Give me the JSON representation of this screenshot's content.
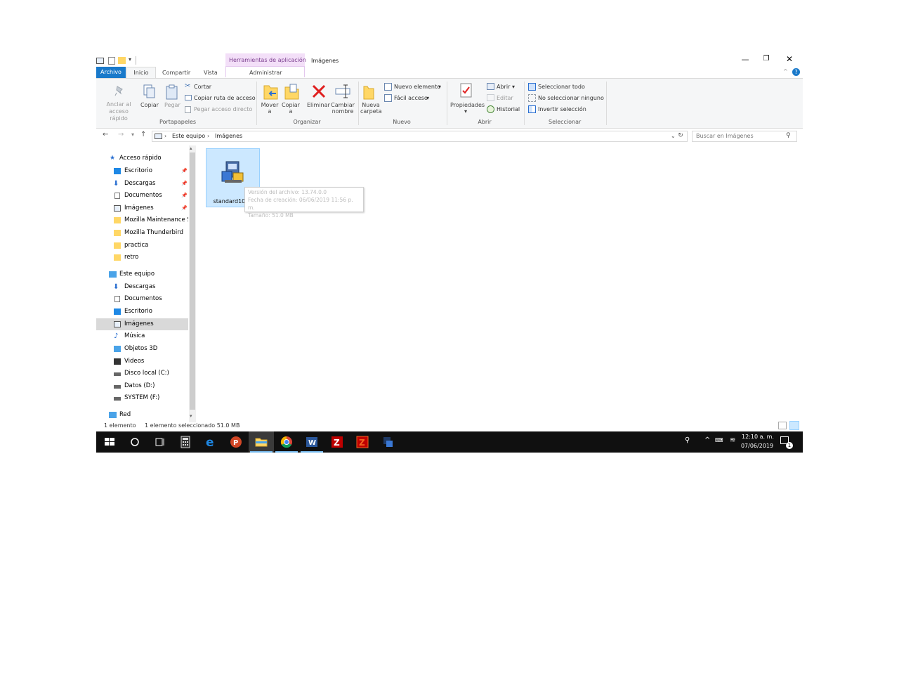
{
  "window": {
    "context_tab": "Herramientas de aplicación",
    "title": "Imágenes",
    "tabs": {
      "file": "Archivo",
      "home": "Inicio",
      "share": "Compartir",
      "view": "Vista",
      "manage": "Administrar"
    }
  },
  "ribbon": {
    "clipboard": {
      "pin": "Anclar al acceso rápido",
      "copy": "Copiar",
      "paste": "Pegar",
      "cut": "Cortar",
      "copy_path": "Copiar ruta de acceso",
      "paste_shortcut": "Pegar acceso directo",
      "group": "Portapapeles"
    },
    "organize": {
      "move_to": "Mover a",
      "copy_to": "Copiar a",
      "delete": "Eliminar",
      "rename": "Cambiar nombre",
      "group": "Organizar"
    },
    "new": {
      "new_folder": "Nueva carpeta",
      "new_item": "Nuevo elemento",
      "easy_access": "Fácil acceso",
      "group": "Nuevo"
    },
    "open": {
      "properties": "Propiedades",
      "open": "Abrir",
      "edit": "Editar",
      "history": "Historial",
      "group": "Abrir"
    },
    "select": {
      "select_all": "Seleccionar todo",
      "select_none": "No seleccionar ninguno",
      "invert": "Invertir selección",
      "group": "Seleccionar"
    }
  },
  "address": {
    "crumbs": [
      "Este equipo",
      "Imágenes"
    ],
    "search_placeholder": "Buscar en Imágenes"
  },
  "nav": {
    "quick_access": "Acceso rápido",
    "quick_items": [
      "Escritorio",
      "Descargas",
      "Documentos",
      "Imágenes",
      "Mozilla Maintenance Se",
      "Mozilla Thunderbird",
      "practica",
      "retro"
    ],
    "this_pc": "Este equipo",
    "pc_items": [
      "Descargas",
      "Documentos",
      "Escritorio",
      "Imágenes",
      "Música",
      "Objetos 3D",
      "Videos",
      "Disco local (C:)",
      "Datos (D:)",
      "SYSTEM (F:)"
    ],
    "network": "Red"
  },
  "files": [
    {
      "name": "standard1024"
    }
  ],
  "tooltip": {
    "version": "Versión del archivo: 13.74.0.0",
    "created": "Fecha de creación: 06/06/2019 11:56 p. m.",
    "size": "Tamaño: 51.0 MB"
  },
  "status": {
    "count": "1 elemento",
    "selected": "1 elemento seleccionado 51.0 MB"
  },
  "taskbar": {
    "time": "12:10 a. m.",
    "date": "07/06/2019",
    "notifications": "1"
  },
  "colors": {
    "accent": "#1979ca",
    "selection": "#cce8ff",
    "context_tab": "#f3dff8",
    "taskbar": "#101010"
  }
}
